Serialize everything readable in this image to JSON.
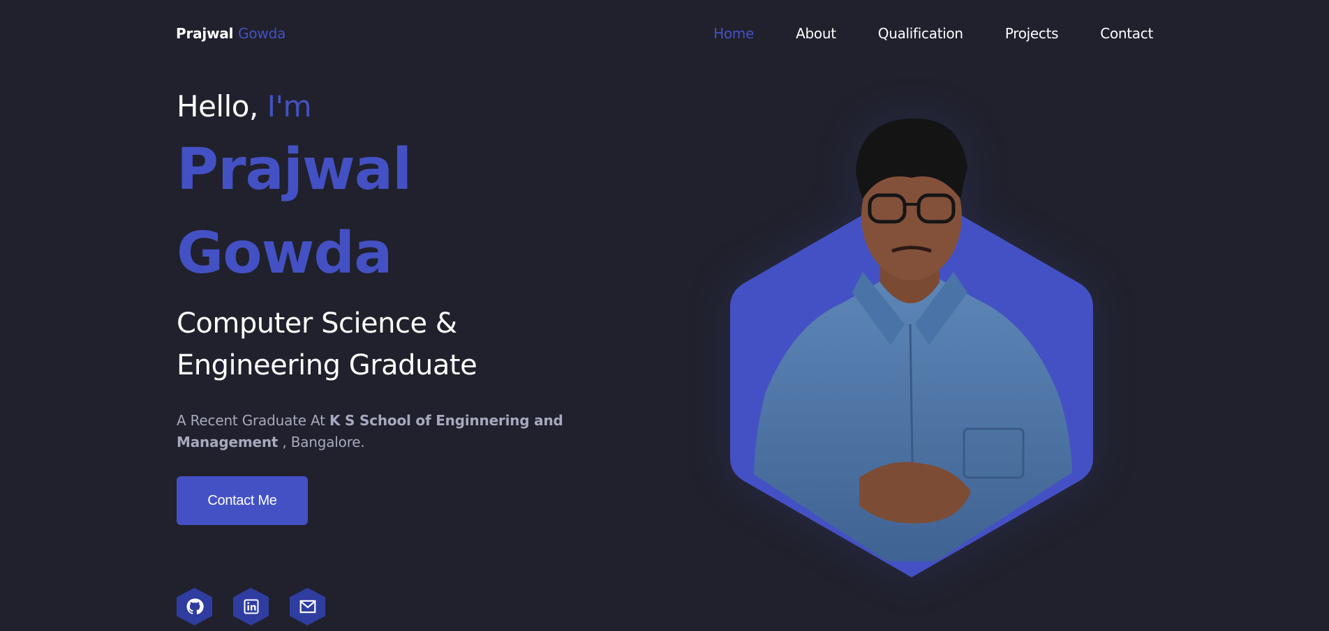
{
  "nav": {
    "logo_first": "Prajwal",
    "logo_second": "Gowda",
    "links": [
      "Home",
      "About",
      "Qualification",
      "Projects",
      "Contact"
    ]
  },
  "hero": {
    "greeting_hello": "Hello,",
    "greeting_im": "I'm",
    "name_first": "Prajwal",
    "name_last": "Gowda",
    "subtitle_line1": "Computer Science &",
    "subtitle_line2": "Engineering Graduate",
    "desc_prefix": "A Recent Graduate At",
    "desc_school": "K S School of Enginnering and Management",
    "desc_suffix": ", Bangalore.",
    "cta_label": "Contact Me"
  },
  "socials": [
    "github-icon",
    "linkedin-icon",
    "mail-icon"
  ],
  "colors": {
    "background": "#20212c",
    "accent": "#4451c4",
    "text": "#ffffff",
    "muted": "#a7a9be"
  }
}
